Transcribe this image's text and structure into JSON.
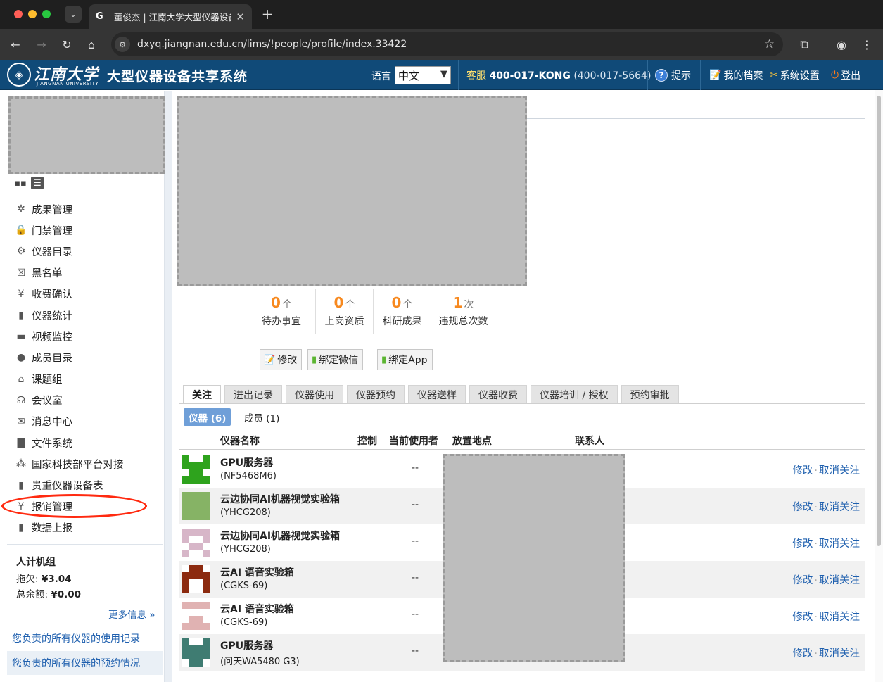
{
  "browser": {
    "tab_title": "董俊杰 | 江南大学大型仪器设备",
    "favicon": "G",
    "url": "dxyq.jiangnan.edu.cn/lims/!people/profile/index.33422"
  },
  "header": {
    "logo_cn": "江南大学",
    "logo_en": "JIANGNAN UNIVERSITY",
    "system_title": "大型仪器设备共享系统",
    "lang_label": "语言",
    "lang_value": "中文",
    "service_label": "客服",
    "service_number": "400-017-KONG",
    "service_alt": "(400-017-5664)",
    "hint": "提示",
    "my_profile": "我的档案",
    "settings": "系统设置",
    "logout": "登出"
  },
  "sidebar": {
    "menu": [
      {
        "label": "成果管理",
        "icon": "trophy-icon",
        "glyph": "✲"
      },
      {
        "label": "门禁管理",
        "icon": "door-lock-icon",
        "glyph": "🔒"
      },
      {
        "label": "仪器目录",
        "icon": "gear-icon",
        "glyph": "⚙"
      },
      {
        "label": "黑名单",
        "icon": "blacklist-icon",
        "glyph": "☒"
      },
      {
        "label": "收费确认",
        "icon": "yen-icon",
        "glyph": "¥"
      },
      {
        "label": "仪器统计",
        "icon": "bar-chart-icon",
        "glyph": "▮"
      },
      {
        "label": "视频监控",
        "icon": "camera-icon",
        "glyph": "▬"
      },
      {
        "label": "成员目录",
        "icon": "person-icon",
        "glyph": "●"
      },
      {
        "label": "课题组",
        "icon": "home-icon",
        "glyph": "⌂"
      },
      {
        "label": "会议室",
        "icon": "meeting-icon",
        "glyph": "☊"
      },
      {
        "label": "消息中心",
        "icon": "message-icon",
        "glyph": "✉"
      },
      {
        "label": "文件系统",
        "icon": "folder-icon",
        "glyph": "▇"
      },
      {
        "label": "国家科技部平台对接",
        "icon": "network-icon",
        "glyph": "⁂"
      },
      {
        "label": "贵重仪器设备表",
        "icon": "bar-chart-icon",
        "glyph": "▮"
      },
      {
        "label": "报销管理",
        "icon": "yen-icon",
        "glyph": "¥"
      },
      {
        "label": "数据上报",
        "icon": "bar-chart-icon",
        "glyph": "▮"
      }
    ],
    "account": {
      "name": "人计机组",
      "owed_label": "拖欠:",
      "owed_value": "¥3.04",
      "balance_label": "总余额:",
      "balance_value": "¥0.00",
      "more": "更多信息 »"
    },
    "links": [
      "您负责的所有仪器的使用记录",
      "您负责的所有仪器的预约情况"
    ]
  },
  "profile": {
    "stats": [
      {
        "num": "0",
        "unit": "个",
        "label": "待办事宜"
      },
      {
        "num": "0",
        "unit": "个",
        "label": "上岗资质"
      },
      {
        "num": "0",
        "unit": "个",
        "label": "科研成果"
      },
      {
        "num": "1",
        "unit": "次",
        "label": "违规总次数"
      }
    ],
    "buttons": {
      "edit": "修改",
      "bind_wechat": "绑定微信",
      "bind_app": "绑定App"
    }
  },
  "tabs": [
    "关注",
    "进出记录",
    "仪器使用",
    "仪器预约",
    "仪器送样",
    "仪器收费",
    "仪器培训 / 授权",
    "预约审批"
  ],
  "subtabs": {
    "instruments": "仪器 (6)",
    "members": "成员 (1)"
  },
  "table": {
    "headers": {
      "name": "仪器名称",
      "control": "控制",
      "current_user": "当前使用者",
      "location": "放置地点",
      "contact": "联系人"
    },
    "rows": [
      {
        "name": "GPU服务器",
        "model": "(NF5468M6)",
        "current_user": "--",
        "edit": "修改",
        "unfollow": "取消关注"
      },
      {
        "name": "云边协同AI机器视觉实验箱",
        "model": "(YHCG208)",
        "current_user": "--",
        "edit": "修改",
        "unfollow": "取消关注"
      },
      {
        "name": "云边协同AI机器视觉实验箱",
        "model": "(YHCG208)",
        "current_user": "--",
        "edit": "修改",
        "unfollow": "取消关注"
      },
      {
        "name": "云AI 语音实验箱",
        "model": "(CGKS-69)",
        "current_user": "--",
        "edit": "修改",
        "unfollow": "取消关注"
      },
      {
        "name": "云AI 语音实验箱",
        "model": "(CGKS-69)",
        "current_user": "--",
        "edit": "修改",
        "unfollow": "取消关注"
      },
      {
        "name": "GPU服务器",
        "model": "(问天WA5480 G3)",
        "current_user": "--",
        "edit": "修改",
        "unfollow": "取消关注"
      }
    ],
    "thumb_colors": [
      "#2ea31d",
      "#86b365",
      "#d7b6c8",
      "#8c2a0f",
      "#e0b2b2",
      "#3f7c72"
    ]
  },
  "colors": {
    "header_bg": "#104a78",
    "link": "#1e5fae",
    "stat_number": "#f7891f",
    "active_subtab": "#6f9fd8",
    "highlight_ring": "#ff2a10"
  }
}
